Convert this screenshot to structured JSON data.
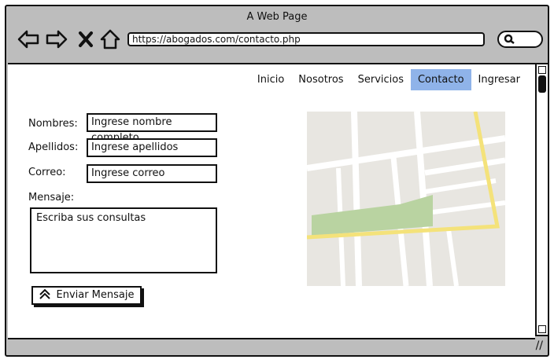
{
  "window": {
    "title": "A Web Page"
  },
  "browser": {
    "url": "https://abogados.com/contacto.php"
  },
  "nav": {
    "items": [
      "Inicio",
      "Nosotros",
      "Servicios",
      "Contacto",
      "Ingresar"
    ],
    "active": "Contacto"
  },
  "form": {
    "nombres_label": "Nombres:",
    "nombres_placeholder": "Ingrese nombre completo",
    "apellidos_label": "Apellidos:",
    "apellidos_placeholder": "Ingrese apellidos",
    "correo_label": "Correo:",
    "correo_placeholder": "Ingrese correo",
    "mensaje_label": "Mensaje:",
    "mensaje_placeholder": "Escriba sus consultas",
    "submit_label": "Enviar Mensaje"
  },
  "colors": {
    "active_tab": "#8fb3e9",
    "chrome": "#bdbdbd",
    "map_road_highlight": "#f4e27a",
    "map_park": "#b9d3a1"
  }
}
